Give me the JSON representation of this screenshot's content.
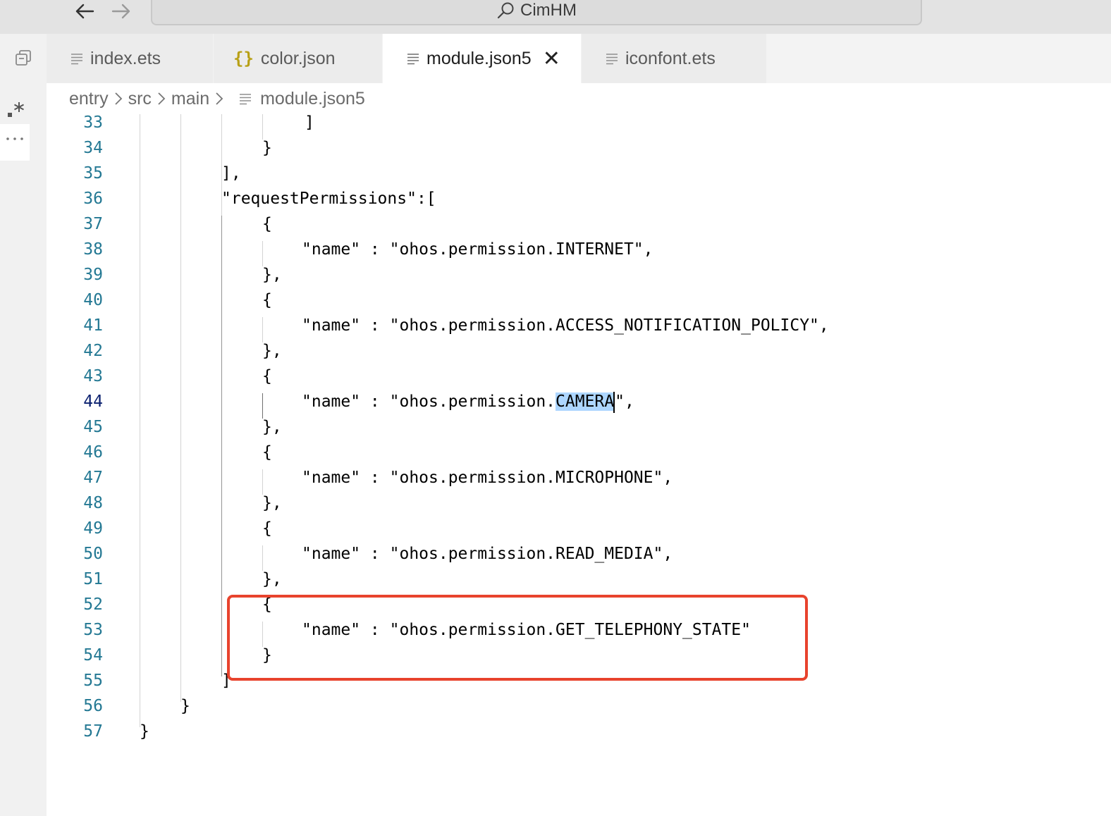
{
  "window": {
    "title": "CimHM"
  },
  "titlebar": {
    "back_icon": "arrow-left-icon",
    "forward_icon": "arrow-right-icon",
    "search_icon": "search-icon"
  },
  "tabs": [
    {
      "label": "index.ets",
      "icon": "file-lines-icon",
      "active": false
    },
    {
      "label": "color.json",
      "icon": "json-braces-icon",
      "active": false
    },
    {
      "label": "module.json5",
      "icon": "file-lines-icon",
      "active": true,
      "close_glyph": "✕"
    },
    {
      "label": "iconfont.ets",
      "icon": "file-lines-icon",
      "active": false
    }
  ],
  "breadcrumb": [
    "entry",
    "src",
    "main",
    "module.json5"
  ],
  "editor": {
    "current_line": 44,
    "lines": [
      {
        "n": "33",
        "text": "]"
      },
      {
        "n": "34",
        "text": "}"
      },
      {
        "n": "35",
        "text": "],"
      },
      {
        "n": "36",
        "text": "\"requestPermissions\":["
      },
      {
        "n": "37",
        "text": "{"
      },
      {
        "n": "38",
        "text": "\"name\" : \"ohos.permission.INTERNET\","
      },
      {
        "n": "39",
        "text": "},"
      },
      {
        "n": "40",
        "text": "{"
      },
      {
        "n": "41",
        "text": "\"name\" : \"ohos.permission.ACCESS_NOTIFICATION_POLICY\","
      },
      {
        "n": "42",
        "text": "},"
      },
      {
        "n": "43",
        "text": "{"
      },
      {
        "n": "44",
        "pre": "\"name\" : \"ohos.permission.",
        "sel": "CAMERA",
        "post": "\","
      },
      {
        "n": "45",
        "text": "},"
      },
      {
        "n": "46",
        "text": "{"
      },
      {
        "n": "47",
        "text": "\"name\" : \"ohos.permission.MICROPHONE\","
      },
      {
        "n": "48",
        "text": "},"
      },
      {
        "n": "49",
        "text": "{"
      },
      {
        "n": "50",
        "text": "\"name\" : \"ohos.permission.READ_MEDIA\","
      },
      {
        "n": "51",
        "text": "},"
      },
      {
        "n": "52",
        "text": "{"
      },
      {
        "n": "53",
        "text": "\"name\" : \"ohos.permission.GET_TELEPHONY_STATE\""
      },
      {
        "n": "54",
        "text": "}"
      },
      {
        "n": "55",
        "text": "]"
      },
      {
        "n": "56",
        "text": "}"
      },
      {
        "n": "57",
        "text": "}"
      }
    ]
  },
  "colors": {
    "line_number": "#237893",
    "selection": "#add6ff",
    "highlight_box": "#e8432d"
  }
}
